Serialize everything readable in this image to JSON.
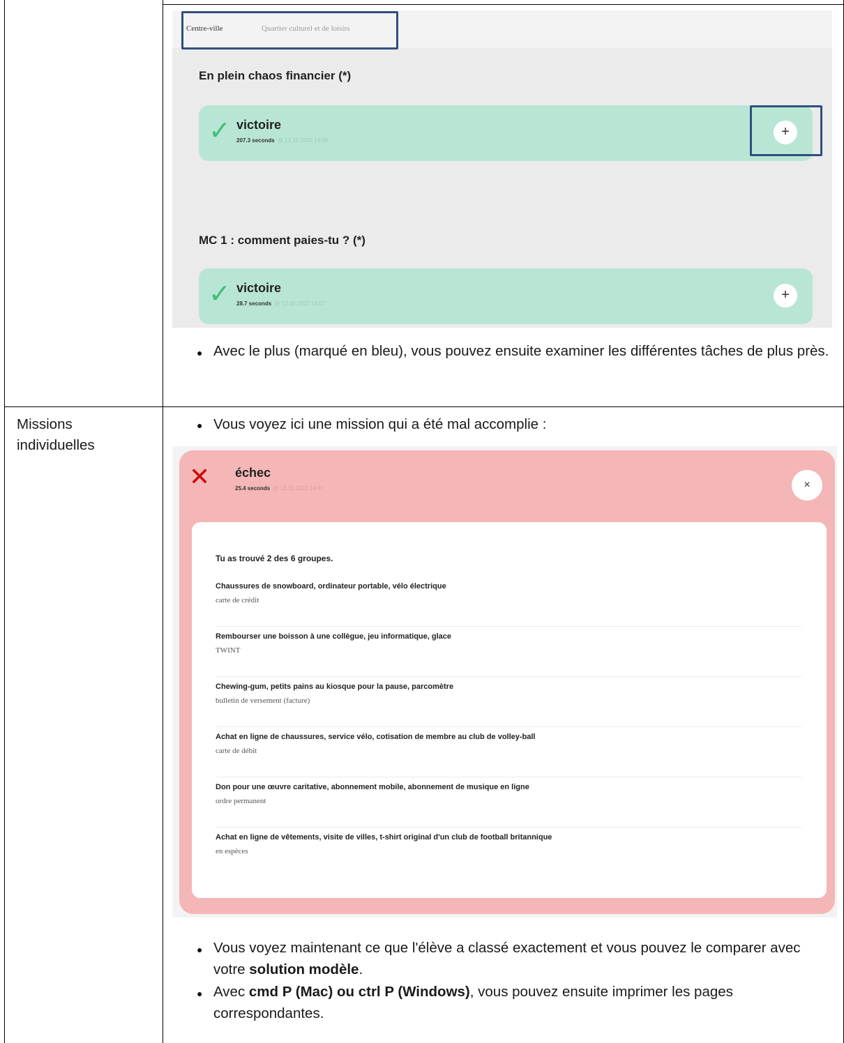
{
  "screen1": {
    "tabs": [
      "Centre-ville",
      "Quartier culturel et de loisirs"
    ],
    "sections": [
      {
        "title": "En plein chaos financier (*)",
        "result": "victoire",
        "time": "207.3 seconds",
        "timestamp": "@ 13.10.2022 14:06"
      },
      {
        "title": "MC 1 : comment paies-tu ? (*)",
        "result": "victoire",
        "time": "28.7 seconds",
        "timestamp": "@ 13.10.2022 14:07"
      }
    ],
    "plus_symbol": "+"
  },
  "text": {
    "bullet1": "Avec le plus (marqué en bleu), vous pouvez ensuite examiner les différentes tâches de plus près.",
    "row2_label": "Missions individuelles",
    "bullet2": "Vous voyez ici une mission qui a été mal accomplie :",
    "bullet3_pre": "Vous voyez maintenant ce que l'élève a classé exactement et vous pouvez le comparer avec votre ",
    "bullet3_bold": "solution modèle",
    "bullet3_post": ".",
    "bullet4_pre": "Avec ",
    "bullet4_bold": "cmd P (Mac) ou ctrl P (Windows)",
    "bullet4_post": ", vous pouvez ensuite imprimer les pages correspondantes."
  },
  "screen2": {
    "result": "échec",
    "time": "25.4 seconds",
    "timestamp": "@ 13.10.2022 14:07",
    "close_symbol": "×",
    "summary": "Tu as trouvé 2 des 6 groupes.",
    "groups": [
      {
        "items": "Chaussures de snowboard, ordinateur portable, vélo électrique",
        "answer": "carte de crédit"
      },
      {
        "items": "Rembourser une boisson à une collègue, jeu informatique, glace",
        "answer": "TWINT"
      },
      {
        "items": "Chewing-gum, petits pains au kiosque pour la pause, parcomètre",
        "answer": "bulletin de versement (facture)"
      },
      {
        "items": "Achat en ligne de chaussures, service vélo, cotisation de membre au club de volley-ball",
        "answer": "carte de débit"
      },
      {
        "items": "Don pour une œuvre caritative, abonnement mobile, abonnement de musique en ligne",
        "answer": "ordre permanent"
      },
      {
        "items": "Achat en ligne de vêtements, visite de villes, t-shirt original d'un club de football britannique",
        "answer": "en espèces"
      }
    ]
  },
  "colors": {
    "success_bg": "#b9e6d4",
    "success_check": "#3fbf7c",
    "fail_bg": "#f4b6b6",
    "fail_cross": "#cc0a0a",
    "highlight_box": "#2f4f7f"
  }
}
